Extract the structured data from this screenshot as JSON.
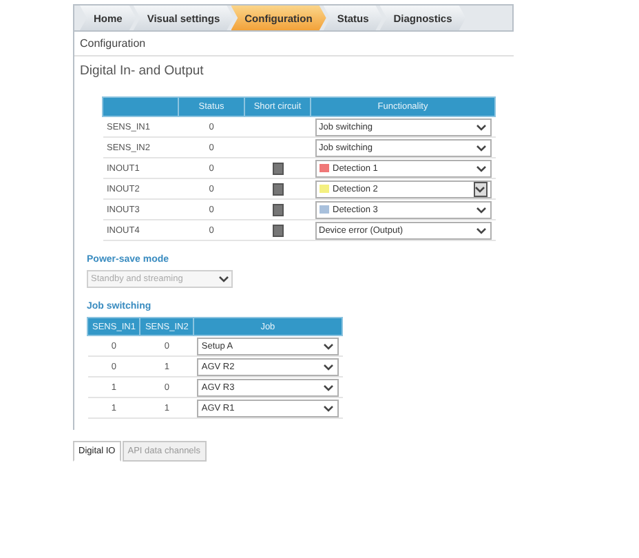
{
  "tabs": [
    {
      "label": "Home",
      "selected": false
    },
    {
      "label": "Visual settings",
      "selected": false
    },
    {
      "label": "Configuration",
      "selected": true
    },
    {
      "label": "Status",
      "selected": false
    },
    {
      "label": "Diagnostics",
      "selected": false
    }
  ],
  "breadcrumb": "Configuration",
  "section_title": "Digital In- and Output",
  "io_table": {
    "columns": [
      "Status",
      "Short circuit",
      "Functionality"
    ],
    "rows": [
      {
        "name": "SENS_IN1",
        "status": "0",
        "short_circuit": false,
        "functionality": "Job switching",
        "focused": false
      },
      {
        "name": "SENS_IN2",
        "status": "0",
        "short_circuit": false,
        "functionality": "Job switching",
        "focused": false
      },
      {
        "name": "INOUT1",
        "status": "0",
        "short_circuit": true,
        "functionality": "Detection 1",
        "color": "#f07878",
        "focused": false
      },
      {
        "name": "INOUT2",
        "status": "0",
        "short_circuit": true,
        "functionality": "Detection 2",
        "color": "#f4f080",
        "focused": true
      },
      {
        "name": "INOUT3",
        "status": "0",
        "short_circuit": true,
        "functionality": "Detection 3",
        "color": "#a8c0dc",
        "focused": false
      },
      {
        "name": "INOUT4",
        "status": "0",
        "short_circuit": true,
        "functionality": "Device error (Output)",
        "focused": false
      }
    ]
  },
  "power_save": {
    "label": "Power-save mode",
    "value": "Standby and streaming",
    "disabled": true
  },
  "job_switching": {
    "label": "Job switching",
    "columns": [
      "SENS_IN1",
      "SENS_IN2",
      "Job"
    ],
    "rows": [
      {
        "in1": "0",
        "in2": "0",
        "job": "Setup A"
      },
      {
        "in1": "0",
        "in2": "1",
        "job": "AGV R2"
      },
      {
        "in1": "1",
        "in2": "0",
        "job": "AGV R3"
      },
      {
        "in1": "1",
        "in2": "1",
        "job": "AGV R1"
      }
    ]
  },
  "bottom_tabs": [
    {
      "label": "Digital IO",
      "selected": true
    },
    {
      "label": "API data channels",
      "selected": false
    }
  ]
}
